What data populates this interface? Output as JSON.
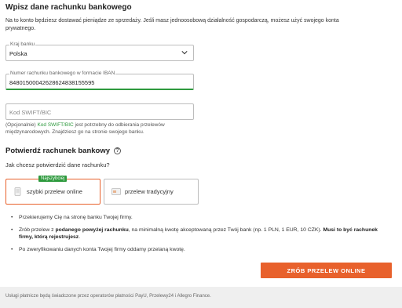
{
  "heading": "Wpisz dane rachunku bankowego",
  "intro": "Na to konto będziesz dostawać pieniądze ze sprzedaży. Jeśli masz jednoosobową działalność gospodarczą, możesz użyć swojego konta prywatnego.",
  "country": {
    "label": "Kraj banku",
    "value": "Polska"
  },
  "iban": {
    "label": "Numer rachunku bankowego w formacie IBAN",
    "value": "84801500042628624838155595"
  },
  "swift": {
    "placeholder": "Kod SWIFT/BIC"
  },
  "swift_help": {
    "prefix": "(Opcjonalnie) ",
    "link": "Kod SWIFT/BIC",
    "rest": " jest potrzebny do odbierania przelewów międzynarodowych. Znajdziesz go na stronie swojego banku."
  },
  "confirm": {
    "heading": "Potwierdź rachunek bankowy",
    "help_icon": "?",
    "question": "Jak chcesz potwierdzić dane rachunku?",
    "badge": "Najszybciej",
    "options": [
      {
        "label": "szybki przelew online",
        "selected": true
      },
      {
        "label": "przelew tradycyjny",
        "selected": false
      }
    ]
  },
  "bullets": {
    "b1": "Przekierujemy Cię na stronę banku Twojej firmy.",
    "b2_a": "Zrób przelew z ",
    "b2_b": "podanego powyżej rachunku",
    "b2_c": ", na minimalną kwotę akceptowaną przez Twój bank (np. 1 PLN, 1 EUR, 10 CZK). ",
    "b2_d": "Musi to być rachunek firmy, którą rejestrujesz",
    "b2_e": ".",
    "b3": "Po zweryfikowaniu danych konta Twojej firmy oddamy przelaną kwotę."
  },
  "cta": "ZRÓB PRZELEW ONLINE",
  "footer": "Usługi płatnicze będą świadczone przez operatorów płatności PayU, Przelewy24 i Allegro Finance.",
  "colors": {
    "accent": "#e8612c",
    "green": "#2e9a3e"
  }
}
